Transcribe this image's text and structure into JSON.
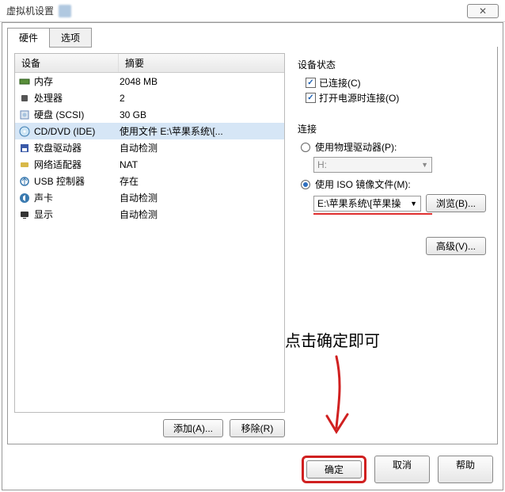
{
  "window": {
    "title": "虚拟机设置",
    "close_glyph": "✕"
  },
  "tabs": {
    "hardware": "硬件",
    "options": "选项"
  },
  "columns": {
    "device": "设备",
    "summary": "摘要"
  },
  "devices": [
    {
      "icon": "memory-icon",
      "name": "内存",
      "summary": "2048 MB"
    },
    {
      "icon": "cpu-icon",
      "name": "处理器",
      "summary": "2"
    },
    {
      "icon": "disk-icon",
      "name": "硬盘 (SCSI)",
      "summary": "30 GB"
    },
    {
      "icon": "cd-icon",
      "name": "CD/DVD (IDE)",
      "summary": "使用文件 E:\\苹果系统\\[...",
      "selected": true
    },
    {
      "icon": "floppy-icon",
      "name": "软盘驱动器",
      "summary": "自动检测"
    },
    {
      "icon": "network-icon",
      "name": "网络适配器",
      "summary": "NAT"
    },
    {
      "icon": "usb-icon",
      "name": "USB 控制器",
      "summary": "存在"
    },
    {
      "icon": "sound-icon",
      "name": "声卡",
      "summary": "自动检测"
    },
    {
      "icon": "display-icon",
      "name": "显示",
      "summary": "自动检测"
    }
  ],
  "left_buttons": {
    "add": "添加(A)...",
    "remove": "移除(R)"
  },
  "status": {
    "title": "设备状态",
    "connected": "已连接(C)",
    "connect_power_on": "打开电源时连接(O)"
  },
  "connection": {
    "title": "连接",
    "use_physical": "使用物理驱动器(P):",
    "physical_value": "H:",
    "use_iso": "使用 ISO 镜像文件(M):",
    "iso_value": "E:\\苹果系统\\[苹果操",
    "browse": "浏览(B)...",
    "advanced": "高级(V)..."
  },
  "bottom": {
    "ok": "确定",
    "cancel": "取消",
    "help": "帮助"
  },
  "annotation": "点击确定即可",
  "colors": {
    "highlight": "#d02020",
    "sel_row": "#d6e6f6"
  }
}
